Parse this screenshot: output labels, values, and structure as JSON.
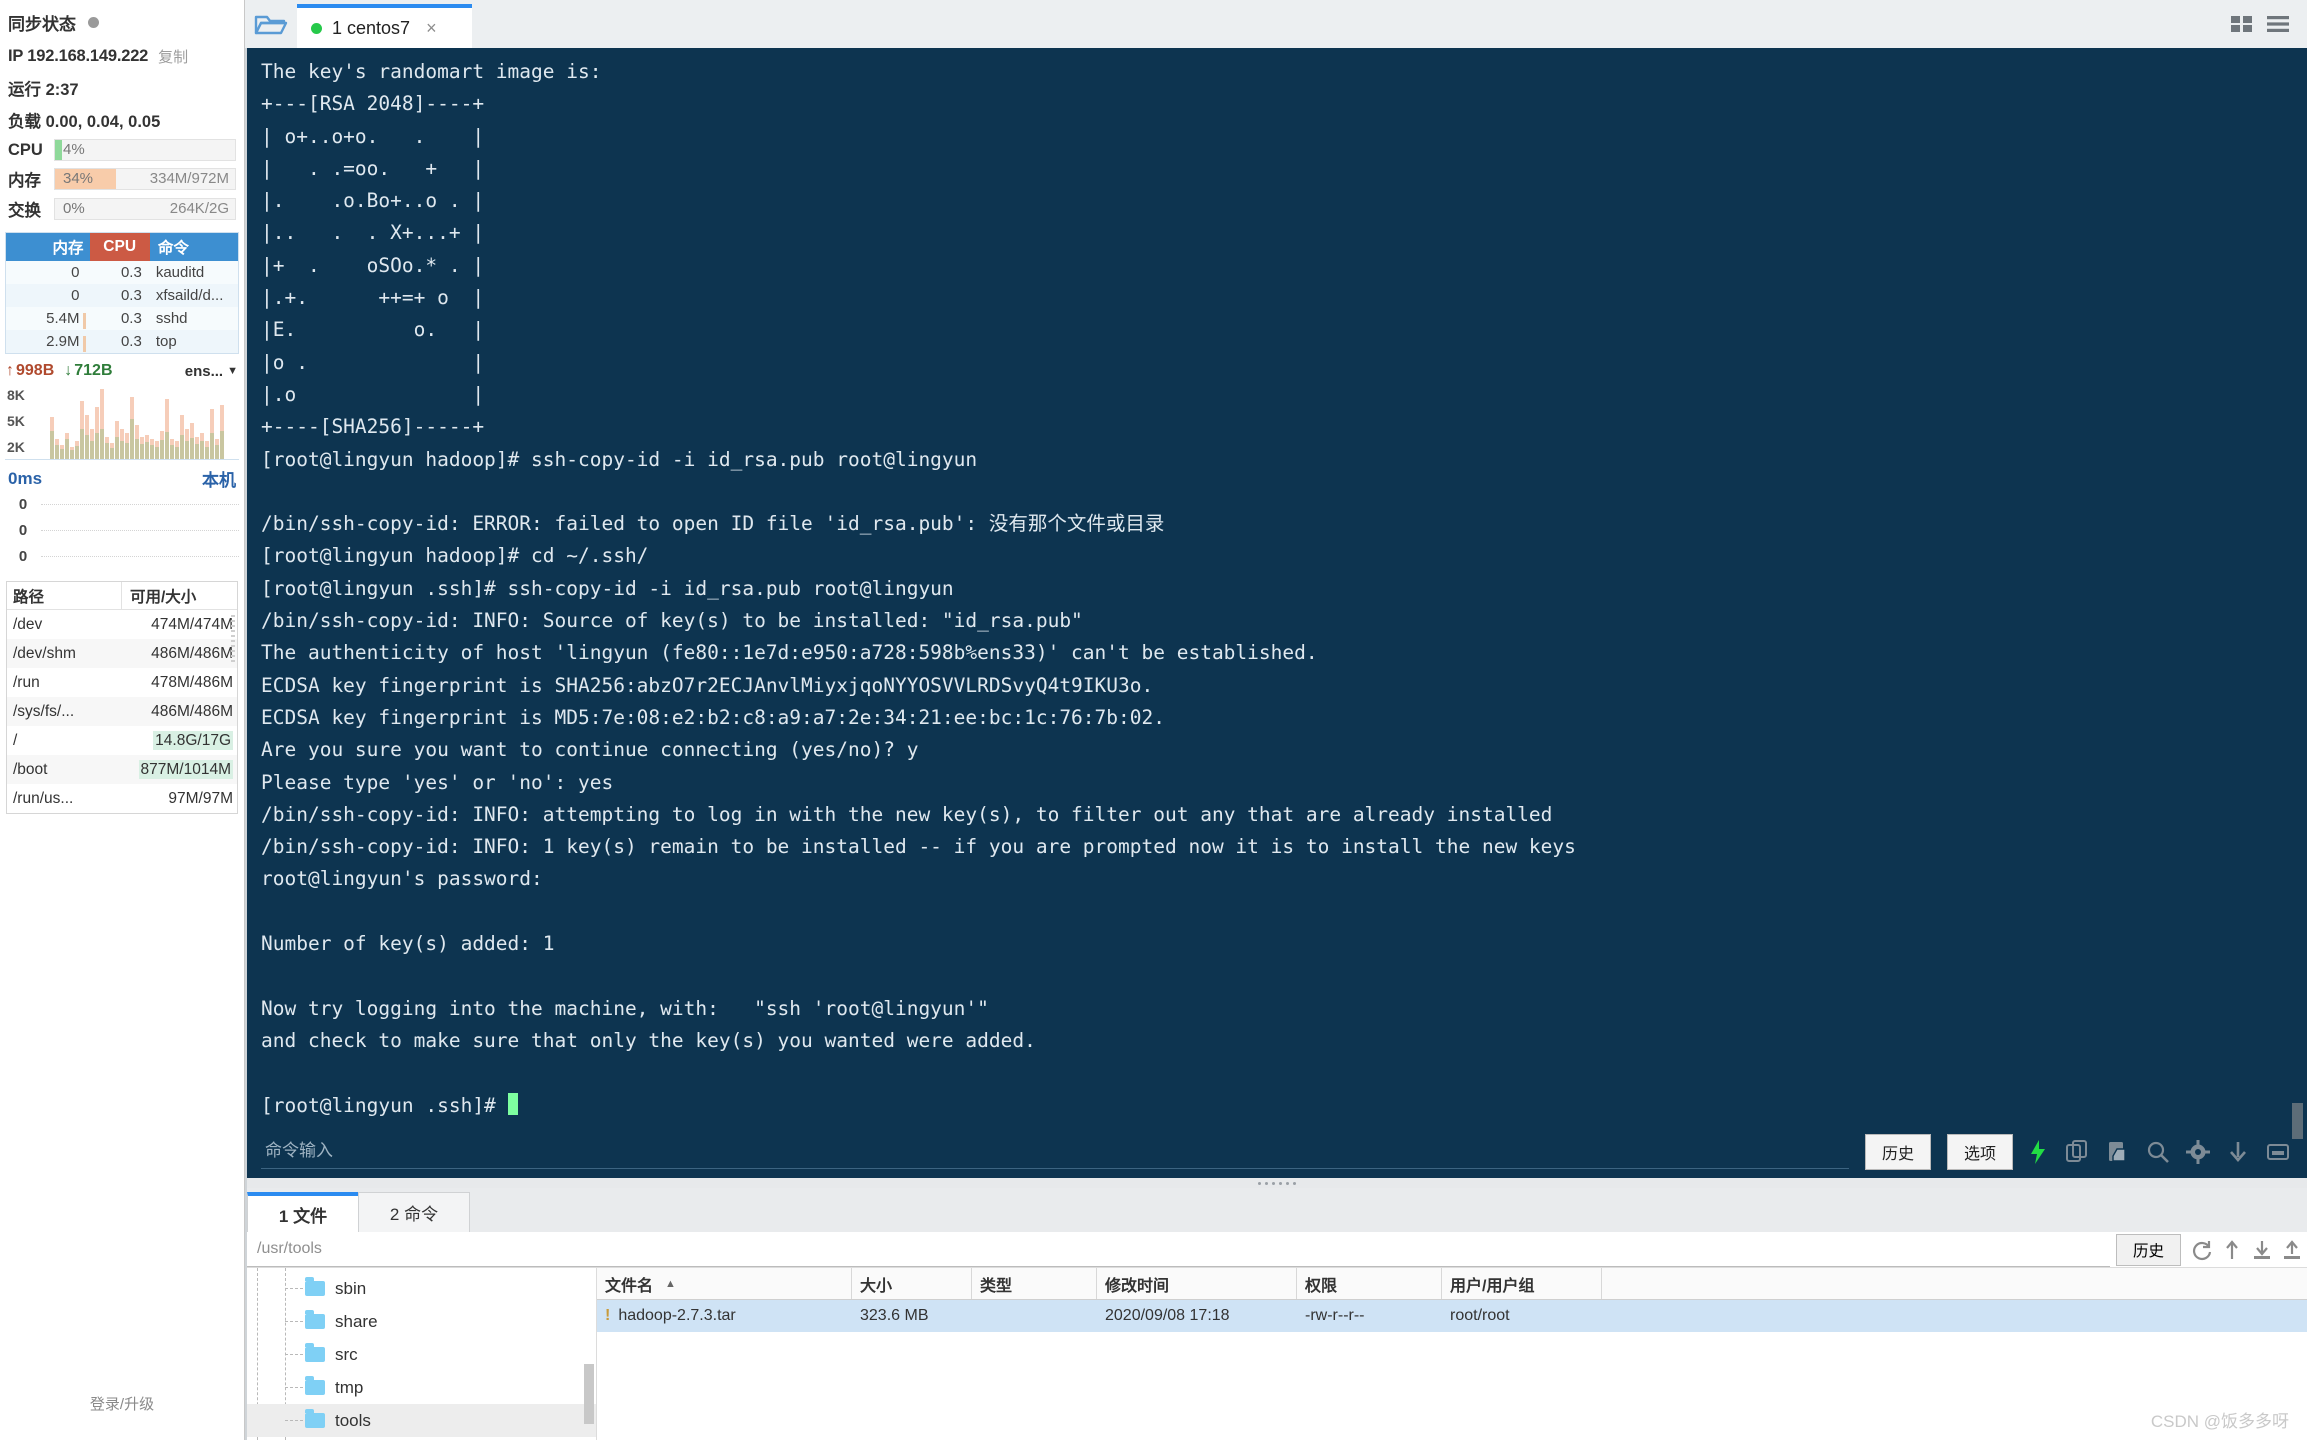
{
  "sidebar": {
    "sync_status_label": "同步状态",
    "ip_label": "IP 192.168.149.222",
    "copy_label": "复制",
    "uptime_label": "运行 2:37",
    "load_label": "负载 0.00, 0.04, 0.05",
    "meters": [
      {
        "name": "CPU",
        "label": "CPU",
        "percent": "4%",
        "fill": 4,
        "color": "#8fd99a",
        "right": ""
      },
      {
        "name": "memory",
        "label": "内存",
        "percent": "34%",
        "fill": 34,
        "color": "#f8ccaa",
        "right": "334M/972M"
      },
      {
        "name": "swap",
        "label": "交换",
        "percent": "0%",
        "fill": 0,
        "color": "#f8ccaa",
        "right": "264K/2G"
      }
    ],
    "process_table": {
      "headers": {
        "mem": "内存",
        "cpu": "CPU",
        "cmd": "命令"
      },
      "rows": [
        {
          "mem": "0",
          "cpu": "0.3",
          "cmd": "kauditd"
        },
        {
          "mem": "0",
          "cpu": "0.3",
          "cmd": "xfsaild/d..."
        },
        {
          "mem": "5.4M",
          "cpu": "0.3",
          "cmd": "sshd"
        },
        {
          "mem": "2.9M",
          "cpu": "0.3",
          "cmd": "top"
        }
      ]
    },
    "network": {
      "upload": "998B",
      "download": "712B",
      "interface": "ens...",
      "y_labels": [
        "8K",
        "5K",
        "2K"
      ]
    },
    "latency": {
      "value": "0ms",
      "target": "本机",
      "rows": [
        "0",
        "0",
        "0"
      ]
    },
    "disk_table": {
      "headers": {
        "path": "路径",
        "size": "可用/大小"
      },
      "rows": [
        {
          "path": "/dev",
          "size": "474M/474M",
          "highlight": false
        },
        {
          "path": "/dev/shm",
          "size": "486M/486M",
          "highlight": false
        },
        {
          "path": "/run",
          "size": "478M/486M",
          "highlight": false
        },
        {
          "path": "/sys/fs/...",
          "size": "486M/486M",
          "highlight": false
        },
        {
          "path": "/",
          "size": "14.8G/17G",
          "highlight": true
        },
        {
          "path": "/boot",
          "size": "877M/1014M",
          "highlight": true
        },
        {
          "path": "/run/us...",
          "size": "97M/97M",
          "highlight": false
        }
      ]
    },
    "login_label": "登录/升级"
  },
  "tabstrip": {
    "folder_icon": "open-folder-icon",
    "tabs": [
      {
        "label": "1 centos7",
        "status": "connected",
        "close": "×"
      }
    ],
    "window_icons": [
      "grid-view-icon",
      "list-view-icon"
    ]
  },
  "terminal": {
    "lines": [
      "The key's randomart image is:",
      "+---[RSA 2048]----+",
      "| o+..o+o.   .    |",
      "|   . .=oo.   +   |",
      "|.    .o.Bo+..o . |",
      "|..   .  . X+...+ |",
      "|+  .    oSOo.* . |",
      "|.+.      ++=+ o  |",
      "|E.          o.   |",
      "|o .              |",
      "|.o               |",
      "+----[SHA256]-----+",
      "[root@lingyun hadoop]# ssh-copy-id -i id_rsa.pub root@lingyun",
      "",
      "/bin/ssh-copy-id: ERROR: failed to open ID file 'id_rsa.pub': 没有那个文件或目录",
      "[root@lingyun hadoop]# cd ~/.ssh/",
      "[root@lingyun .ssh]# ssh-copy-id -i id_rsa.pub root@lingyun",
      "/bin/ssh-copy-id: INFO: Source of key(s) to be installed: \"id_rsa.pub\"",
      "The authenticity of host 'lingyun (fe80::1e7d:e950:a728:598b%ens33)' can't be established.",
      "ECDSA key fingerprint is SHA256:abzO7r2ECJAnvlMiyxjqoNYYOSVVLRDSvyQ4t9IKU3o.",
      "ECDSA key fingerprint is MD5:7e:08:e2:b2:c8:a9:a7:2e:34:21:ee:bc:1c:76:7b:02.",
      "Are you sure you want to continue connecting (yes/no)? y",
      "Please type 'yes' or 'no': yes",
      "/bin/ssh-copy-id: INFO: attempting to log in with the new key(s), to filter out any that are already installed",
      "/bin/ssh-copy-id: INFO: 1 key(s) remain to be installed -- if you are prompted now it is to install the new keys",
      "root@lingyun's password:",
      "",
      "Number of key(s) added: 1",
      "",
      "Now try logging into the machine, with:   \"ssh 'root@lingyun'\"",
      "and check to make sure that only the key(s) you wanted were added.",
      "",
      "[root@lingyun .ssh]# "
    ],
    "input_placeholder": "命令输入",
    "history_button": "历史",
    "options_button": "选项",
    "icons": [
      "lightning-icon",
      "copy-icon",
      "paste-icon",
      "search-icon",
      "gear-icon",
      "download-icon",
      "minimize-icon"
    ]
  },
  "bottom": {
    "tabs": [
      {
        "label": "1 文件",
        "active": true
      },
      {
        "label": "2 命令",
        "active": false
      }
    ],
    "path": "/usr/tools",
    "history_button": "历史",
    "toolbar_icons": [
      "refresh-icon",
      "up-directory-icon",
      "download-icon",
      "upload-icon"
    ],
    "tree_items": [
      {
        "label": "sbin",
        "selected": false
      },
      {
        "label": "share",
        "selected": false
      },
      {
        "label": "src",
        "selected": false
      },
      {
        "label": "tmp",
        "selected": false
      },
      {
        "label": "tools",
        "selected": true
      }
    ],
    "file_table": {
      "headers": {
        "name": "文件名",
        "size": "大小",
        "type": "类型",
        "mtime": "修改时间",
        "perm": "权限",
        "owner": "用户/用户组"
      },
      "rows": [
        {
          "name": "hadoop-2.7.3.tar",
          "size": "323.6 MB",
          "type": "",
          "mtime": "2020/09/08 17:18",
          "perm": "-rw-r--r--",
          "owner": "root/root"
        }
      ]
    }
  },
  "watermark": "CSDN @饭多多呀"
}
